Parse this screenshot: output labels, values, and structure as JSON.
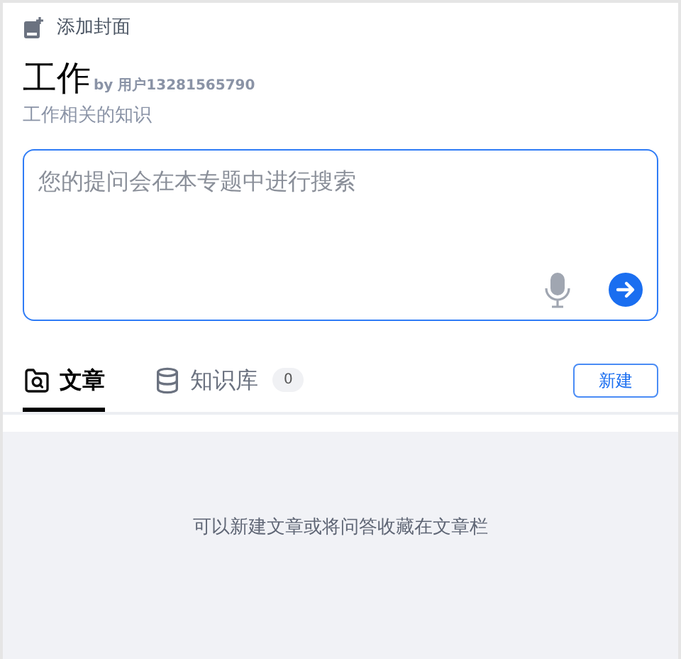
{
  "cover_action": {
    "label": "添加封面"
  },
  "topic": {
    "title": "工作",
    "author": "by 用户13281565790",
    "description": "工作相关的知识"
  },
  "search": {
    "placeholder": "您的提问会在本专题中进行搜索"
  },
  "tabs": [
    {
      "label": "文章",
      "kind": "articles",
      "selected": true
    },
    {
      "label": "知识库",
      "kind": "database",
      "selected": false,
      "count": "0"
    }
  ],
  "new_button": "新建",
  "empty_message": "可以新建文章或将问答收藏在文章栏"
}
